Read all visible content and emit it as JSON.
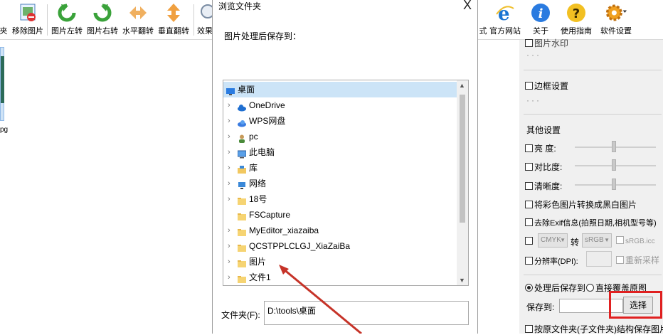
{
  "toolbar": {
    "items": [
      {
        "label": "夹",
        "icon": "folder-icon"
      },
      {
        "label": "移除图片",
        "icon": "remove-image-icon"
      },
      {
        "label": "图片左转",
        "icon": "rotate-left-icon"
      },
      {
        "label": "图片右转",
        "icon": "rotate-right-icon"
      },
      {
        "label": "水平翻转",
        "icon": "flip-horizontal-icon"
      },
      {
        "label": "垂直翻转",
        "icon": "flip-vertical-icon"
      },
      {
        "label": "效果",
        "icon": "effect-icon"
      },
      {
        "label": "式",
        "icon": ""
      },
      {
        "label": "官方网站",
        "icon": "ie-icon"
      },
      {
        "label": "关于",
        "icon": "info-icon"
      },
      {
        "label": "使用指南",
        "icon": "help-icon"
      },
      {
        "label": "软件设置",
        "icon": "gear-icon"
      }
    ]
  },
  "thumbnail": {
    "ext": "pg"
  },
  "dialog": {
    "title": "浏览文件夹",
    "close": "X",
    "prompt": "图片处理后保存到：",
    "tree": [
      {
        "label": "桌面",
        "icon": "desktop-icon",
        "selected": true,
        "expandable": false
      },
      {
        "label": "OneDrive",
        "icon": "cloud-icon",
        "selected": false,
        "expandable": true
      },
      {
        "label": "WPS网盘",
        "icon": "wps-cloud-icon",
        "selected": false,
        "expandable": true
      },
      {
        "label": "pc",
        "icon": "user-icon",
        "selected": false,
        "expandable": true
      },
      {
        "label": "此电脑",
        "icon": "computer-icon",
        "selected": false,
        "expandable": true
      },
      {
        "label": "库",
        "icon": "library-icon",
        "selected": false,
        "expandable": true
      },
      {
        "label": "网络",
        "icon": "network-icon",
        "selected": false,
        "expandable": true
      },
      {
        "label": "18号",
        "icon": "folder-icon",
        "selected": false,
        "expandable": true
      },
      {
        "label": "FSCapture",
        "icon": "folder-icon",
        "selected": false,
        "expandable": false
      },
      {
        "label": "MyEditor_xiazaiba",
        "icon": "folder-icon",
        "selected": false,
        "expandable": true
      },
      {
        "label": "QCSTPPLCLGJ_XiaZaiBa",
        "icon": "folder-icon",
        "selected": false,
        "expandable": true
      },
      {
        "label": "图片",
        "icon": "folder-icon",
        "selected": false,
        "expandable": true
      },
      {
        "label": "文件1",
        "icon": "folder-icon",
        "selected": false,
        "expandable": true
      }
    ],
    "folder_label": "文件夹(F):",
    "folder_value": "D:\\tools\\桌面"
  },
  "right_panel": {
    "watermark": "图片水印",
    "dots": "···",
    "border": "边框设置",
    "other_title": "其他设置",
    "brightness": "亮    度:",
    "contrast": "对比度:",
    "sharpness": "清晰度:",
    "grayscale": "将彩色图片转换成黑白图片",
    "remove_exif": "去除Exif信息(拍照日期,相机型号等)",
    "color_from": "CMYK",
    "convert": "转",
    "color_to": "sRGB",
    "icc": "sRGB.icc",
    "resolution": "分辨率(DPI):",
    "resample": "重新采样",
    "save_to_radio": "处理后保存到",
    "overwrite_radio": "直接覆盖原图",
    "save_label": "保存到:",
    "choose_button": "选择",
    "keep_structure": "按原文件夹(子文件夹)结构保存图片"
  },
  "colors": {
    "highlight": "#e02020",
    "selection": "#cce4f7"
  }
}
